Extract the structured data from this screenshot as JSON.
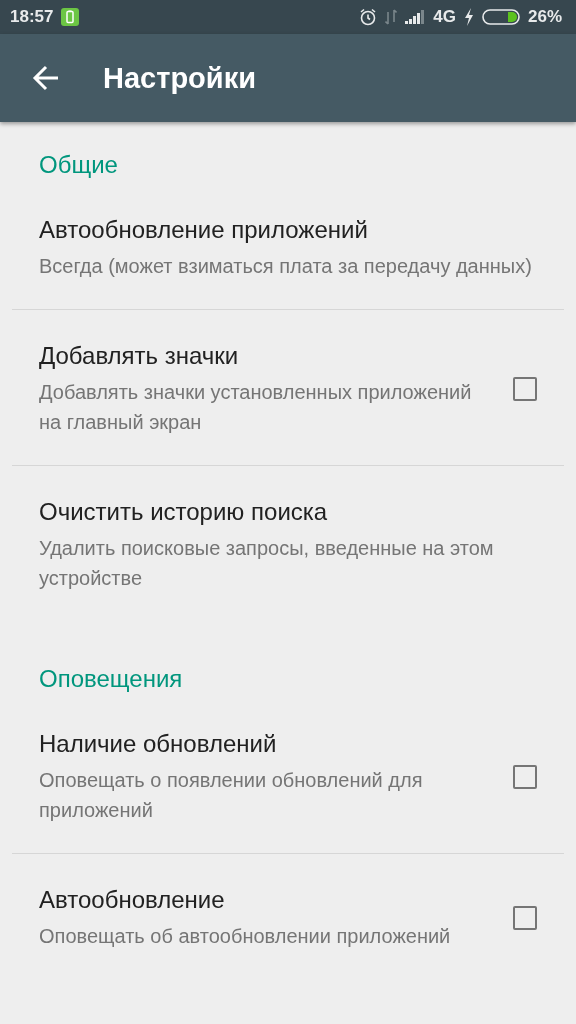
{
  "status_bar": {
    "time": "18:57",
    "network": "4G",
    "battery": "26%"
  },
  "toolbar": {
    "title": "Настройки"
  },
  "sections": [
    {
      "title": "Общие",
      "items": [
        {
          "kind": "plain",
          "title": "Автообновление приложений",
          "summary": "Всегда (может взиматься плата за передачу данных)"
        },
        {
          "kind": "checkbox",
          "title": "Добавлять значки",
          "summary": "Добавлять значки установленных приложений на главный экран",
          "checked": false
        },
        {
          "kind": "plain",
          "title": "Очистить историю поиска",
          "summary": "Удалить поисковые запросы, введенные на этом устройстве"
        }
      ]
    },
    {
      "title": "Оповещения",
      "items": [
        {
          "kind": "checkbox",
          "title": "Наличие обновлений",
          "summary": "Оповещать о появлении обновлений для приложений",
          "checked": false
        },
        {
          "kind": "checkbox",
          "title": "Автообновление",
          "summary": "Оповещать об автообновлении приложений",
          "checked": false
        }
      ]
    }
  ]
}
